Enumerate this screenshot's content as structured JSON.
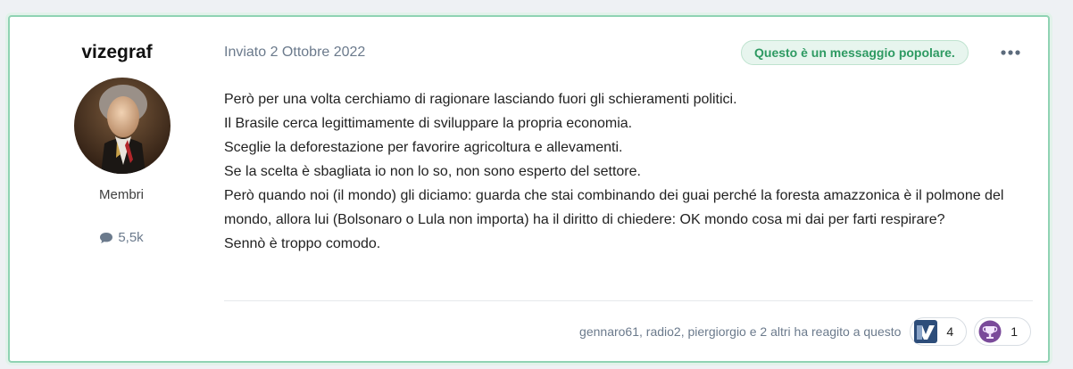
{
  "author": {
    "name": "vizegraf",
    "group": "Membri",
    "post_count": "5,5k",
    "stats_icon": "comment-icon"
  },
  "post": {
    "date": "Inviato 2 Ottobre 2022",
    "badge": "Questo è un messaggio popolare.",
    "menu_icon": "ellipsis-icon",
    "paragraphs": [
      "Però per una volta cerchiamo di ragionare lasciando fuori gli schieramenti politici.",
      "Il Brasile cerca legittimamente di sviluppare la propria economia.",
      "Sceglie la deforestazione per favorire agricoltura e allevamenti.",
      "Se la scelta è sbagliata io non lo so, non sono esperto del settore.",
      "Però quando noi (il mondo) gli diciamo: guarda che stai combinando dei guai perché la foresta amazzonica è il polmone del mondo, allora lui (Bolsonaro o Lula non importa) ha il diritto di chiedere: OK mondo cosa mi dai per farti respirare?",
      "Sennò è troppo comodo."
    ]
  },
  "reactions": {
    "summary": "gennaro61, radio2, piergiorgio e 2 altri ha reagito a questo",
    "items": [
      {
        "icon": "like-reaction-icon",
        "count": "4"
      },
      {
        "icon": "trophy-reaction-icon",
        "count": "1"
      }
    ]
  },
  "colors": {
    "post_border": "#8fd3b3",
    "badge_text": "#2e9a62",
    "badge_bg": "#e7f5ee",
    "muted_text": "#6b7a8c"
  }
}
